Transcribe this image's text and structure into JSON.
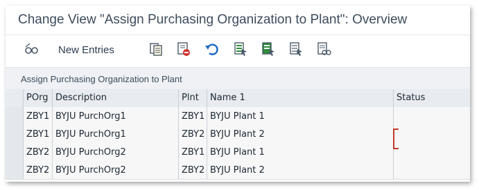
{
  "window": {
    "title": "Change View \"Assign Purchasing Organization to Plant\": Overview"
  },
  "toolbar": {
    "new_entries_label": "New Entries",
    "icons": [
      "display-change-icon",
      "copy-icon",
      "delete-icon",
      "undo-icon",
      "select-all-icon",
      "select-block-icon",
      "deselect-all-icon",
      "configuration-icon"
    ]
  },
  "section": {
    "title": "Assign Purchasing Organization to Plant"
  },
  "table": {
    "headers": {
      "porg": "POrg",
      "description": "Description",
      "plnt": "Plnt",
      "name1": "Name 1",
      "status": "Status"
    },
    "rows": [
      {
        "porg": "ZBY1",
        "description": "BYJU PurchOrg1",
        "plnt": "ZBY1",
        "name1": "BYJU Plant 1",
        "status": ""
      },
      {
        "porg": "ZBY1",
        "description": "BYJU PurchOrg1",
        "plnt": "ZBY2",
        "name1": "BYJU Plant 2",
        "status": ""
      },
      {
        "porg": "ZBY2",
        "description": "BYJU PurchOrg2",
        "plnt": "ZBY1",
        "name1": "BYJU Plant 1",
        "status": ""
      },
      {
        "porg": "ZBY2",
        "description": "BYJU PurchOrg2",
        "plnt": "ZBY2",
        "name1": "BYJU Plant 2",
        "status": ""
      }
    ]
  },
  "colors": {
    "title_text": "#3d4c5c",
    "header_bg": "#e8ebef",
    "row_bg": "#f7f7f7",
    "marker": "#c0392b"
  }
}
